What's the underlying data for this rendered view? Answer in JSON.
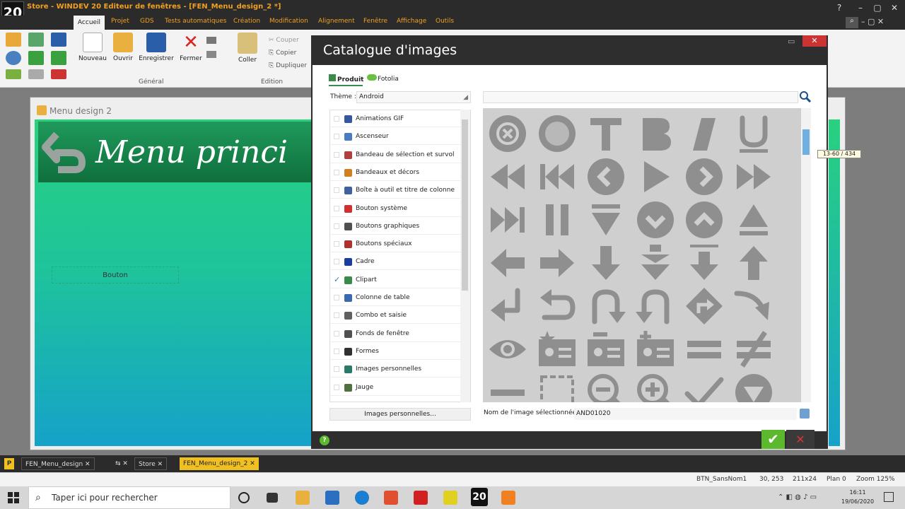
{
  "window": {
    "logo": "20",
    "title": "Store - WINDEV 20  Editeur de fenêtres - [FEN_Menu_design_2 *]"
  },
  "menu": [
    "Accueil",
    "Projet",
    "GDS",
    "Tests automatiques",
    "Création",
    "Modification",
    "Alignement",
    "Fenêtre",
    "Affichage",
    "Outils"
  ],
  "ribbon": {
    "nouveau": "Nouveau",
    "ouvrir": "Ouvrir",
    "enregistrer": "Enregistrer",
    "fermer": "Fermer",
    "coller": "Coller",
    "couper": "Couper",
    "copier": "Copier",
    "dupliquer": "Dupliquer",
    "group_general": "Général",
    "group_edition": "Edition"
  },
  "editor": {
    "window_name": "Menu design 2",
    "banner_title": "Menu princi",
    "button_label": "Bouton"
  },
  "dialog": {
    "title": "Catalogue d'images",
    "tab_produit": "Produit",
    "tab_fotolia": "Fotolia",
    "theme_label": "Thème :",
    "theme_value": "Android",
    "categories": [
      {
        "label": "Animations GIF",
        "checked": false,
        "color": "#3557a0"
      },
      {
        "label": "Ascenseur",
        "checked": false,
        "color": "#4a7bc0"
      },
      {
        "label": "Bandeau de sélection et survol",
        "checked": false,
        "color": "#b04040"
      },
      {
        "label": "Bandeaux et décors",
        "checked": false,
        "color": "#d08020"
      },
      {
        "label": "Boîte à outil et titre de colonne",
        "checked": false,
        "color": "#4060a0"
      },
      {
        "label": "Bouton système",
        "checked": false,
        "color": "#d03030"
      },
      {
        "label": "Boutons graphiques",
        "checked": false,
        "color": "#505050"
      },
      {
        "label": "Boutons spéciaux",
        "checked": false,
        "color": "#b03030"
      },
      {
        "label": "Cadre",
        "checked": false,
        "color": "#1a3ea0"
      },
      {
        "label": "Clipart",
        "checked": true,
        "color": "#3a8a4a"
      },
      {
        "label": "Colonne de table",
        "checked": false,
        "color": "#3a6ab0"
      },
      {
        "label": "Combo et saisie",
        "checked": false,
        "color": "#606060"
      },
      {
        "label": "Fonds de fenêtre",
        "checked": false,
        "color": "#505050"
      },
      {
        "label": "Formes",
        "checked": false,
        "color": "#303030"
      },
      {
        "label": "Images personnelles",
        "checked": false,
        "color": "#2a7a6a"
      },
      {
        "label": "Jauge",
        "checked": false,
        "color": "#507040"
      }
    ],
    "images_perso_button": "Images personnelles...",
    "search_placeholder": "",
    "tooltip": "13-60 / 434",
    "name_label": "Nom de l'image sélectionnée :",
    "name_value": "AND01020",
    "icons": [
      "close-circle-icon",
      "globe-icon",
      "text-icon",
      "bold-icon",
      "italic-icon",
      "underline-icon",
      "rewind-icon",
      "skip-back-icon",
      "chevron-left-circle-icon",
      "play-icon",
      "chevron-right-circle-icon",
      "fast-forward-icon",
      "skip-forward-icon",
      "pause-icon",
      "down-triangle-bar-icon",
      "chevron-down-circle-icon",
      "chevron-up-circle-icon",
      "up-triangle-bar-icon",
      "arrow-left-icon",
      "arrow-right-icon",
      "arrow-down-icon",
      "arrow-down-double-icon",
      "download-icon",
      "arrow-up-icon",
      "return-icon",
      "undo-icon",
      "u-turn-down-icon",
      "u-turn-down-alt-icon",
      "diamond-turn-icon",
      "curved-arrow-icon",
      "eye-icon",
      "contact-card-star-icon",
      "contact-card-icon",
      "contact-card-add-icon",
      "equal-icon",
      "not-equal-icon",
      "minus-icon",
      "selection-icon",
      "zoom-out-icon",
      "zoom-in-icon",
      "check-icon",
      "down-circle-icon"
    ]
  },
  "doc_tabs": [
    "FEN_Menu_design",
    "Store",
    "FEN_Menu_design_2"
  ],
  "status": {
    "control": "BTN_SansNom1",
    "pos": "30, 253",
    "size": "211x24",
    "plan": "Plan 0",
    "zoom": "Zoom 125%"
  },
  "taskbar": {
    "search": "Taper ici pour rechercher",
    "time": "16:11",
    "date": "19/06/2020"
  }
}
